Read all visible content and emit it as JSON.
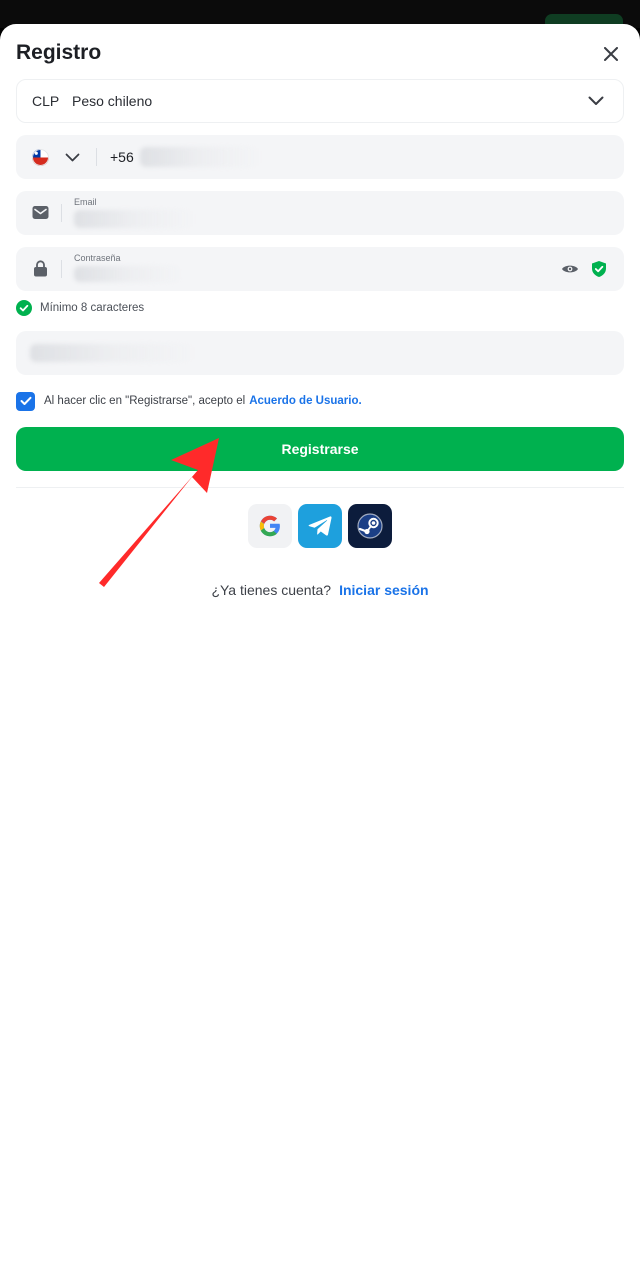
{
  "modal": {
    "title": "Registro",
    "close_icon": "close-icon"
  },
  "currency": {
    "code": "CLP",
    "name": "Peso chileno"
  },
  "phone": {
    "country_flag": "chile-flag-icon",
    "prefix": "+56"
  },
  "email": {
    "label": "Email",
    "icon": "mail-icon"
  },
  "password": {
    "label": "Contraseña",
    "icon": "lock-icon"
  },
  "password_hint": {
    "text": "Mínimo 8 caracteres"
  },
  "terms": {
    "checked": true,
    "text": "Al hacer clic en \"Registrarse\", acepto el",
    "link": "Acuerdo de Usuario."
  },
  "register_button": {
    "label": "Registrarse"
  },
  "social": [
    "google-icon",
    "telegram-icon",
    "steam-icon"
  ],
  "login": {
    "question": "¿Ya tienes cuenta?",
    "link": "Iniciar sesión"
  },
  "colors": {
    "primary_green": "#00b14f",
    "link_blue": "#1a73e8",
    "annotation_arrow": "#ff2a2a"
  }
}
